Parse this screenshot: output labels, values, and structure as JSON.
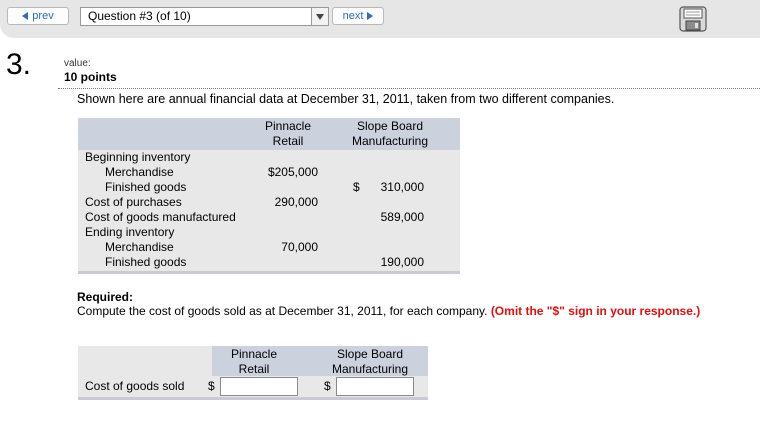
{
  "nav": {
    "prev_label": "prev",
    "question_select_value": "Question #3 (of 10)",
    "next_label": "next"
  },
  "question": {
    "number": "3.",
    "value_label": "value:",
    "points": "10 points",
    "intro": "Shown here are annual financial data at December 31, 2011, taken from two different companies."
  },
  "table": {
    "col1_line1": "Pinnacle",
    "col1_line2": "Retail",
    "col2_line1": "Slope Board",
    "col2_line2": "Manufacturing",
    "rows": [
      {
        "label": "Beginning inventory",
        "c1": "",
        "c2": ""
      },
      {
        "label": "Merchandise",
        "c1": "$205,000",
        "c2": ""
      },
      {
        "label": "Finished goods",
        "c1": "",
        "c2_dollar": "$",
        "c2": "310,000"
      },
      {
        "label": "Cost of purchases",
        "c1": "290,000",
        "c2": ""
      },
      {
        "label": "Cost of goods manufactured",
        "c1": "",
        "c2": "589,000"
      },
      {
        "label": "Ending inventory",
        "c1": "",
        "c2": ""
      },
      {
        "label": "Merchandise",
        "c1": "70,000",
        "c2": ""
      },
      {
        "label": "Finished goods",
        "c1": "",
        "c2": "190,000"
      }
    ]
  },
  "required": {
    "heading": "Required:",
    "text": "Compute the cost of goods sold as at December 31, 2011, for each company.",
    "note": "(Omit the \"$\" sign in your response.)"
  },
  "answer": {
    "col1_line1": "Pinnacle",
    "col1_line2": "Retail",
    "col2_line1": "Slope Board",
    "col2_line2": "Manufacturing",
    "row_label": "Cost of goods sold",
    "dollar1": "$",
    "dollar2": "$",
    "value1": "",
    "value2": ""
  }
}
